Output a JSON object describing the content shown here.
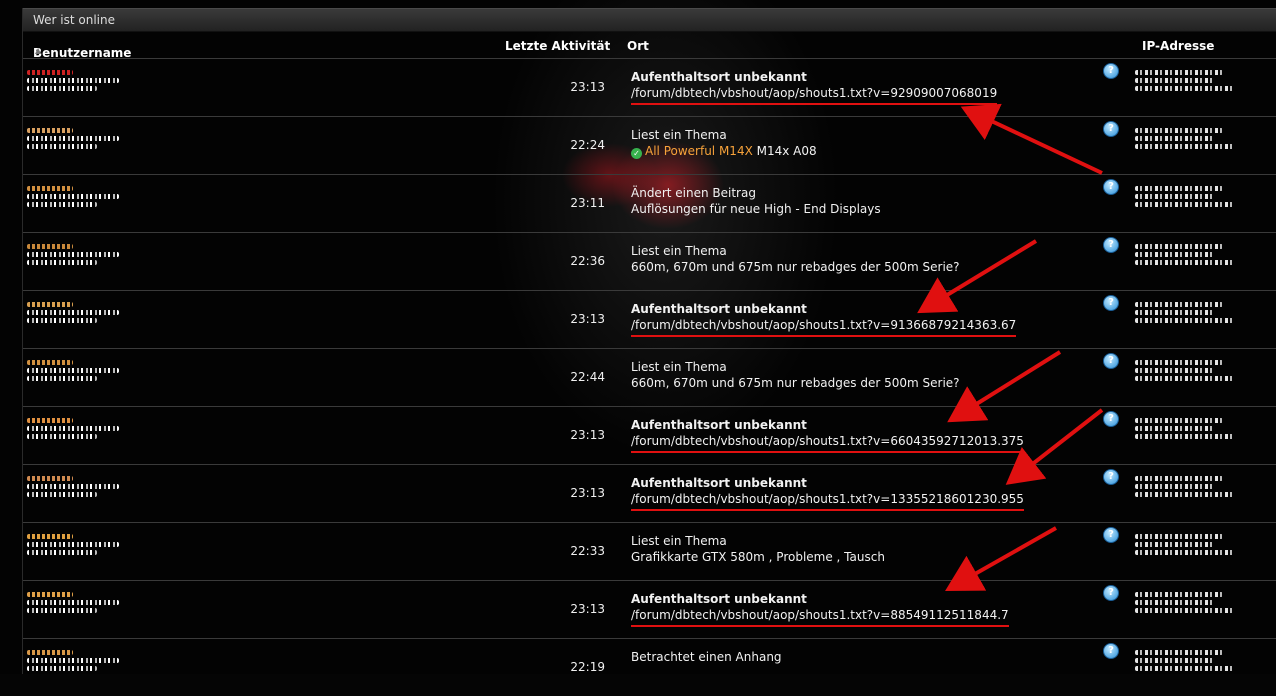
{
  "panel": {
    "title": "Wer ist online"
  },
  "columns": {
    "user": "Benutzername",
    "activity": "Letzte Aktivität",
    "location": "Ort",
    "ip": "IP-Adresse"
  },
  "rows": [
    {
      "time": "23:13",
      "line1": "Aufenthaltsort unbekannt",
      "line2": "/forum/dbtech/vbshout/aop/shouts1.txt?v=92909007068019",
      "bold": true,
      "highlight": true,
      "user_color": "#cc2222"
    },
    {
      "time": "22:24",
      "line1": "Liest ein Thema",
      "thread_link": "All Powerful M14X",
      "thread_suffix": "M14x A08",
      "bold": false,
      "highlight": false,
      "user_color": "#d9a060"
    },
    {
      "time": "23:11",
      "line1": "Ändert einen Beitrag",
      "line2": "Auflösungen für neue High - End Displays",
      "bold": false,
      "highlight": false,
      "user_color": "#d29040"
    },
    {
      "time": "22:36",
      "line1": "Liest ein Thema",
      "line2": "660m, 670m und 675m nur rebadges der 500m Serie?",
      "bold": false,
      "highlight": false,
      "user_color": "#c8883a"
    },
    {
      "time": "23:13",
      "line1": "Aufenthaltsort unbekannt",
      "line2": "/forum/dbtech/vbshout/aop/shouts1.txt?v=91366879214363.67",
      "bold": true,
      "highlight": true,
      "user_color": "#d9a050"
    },
    {
      "time": "22:44",
      "line1": "Liest ein Thema",
      "line2": "660m, 670m und 675m nur rebadges der 500m Serie?",
      "bold": false,
      "highlight": false,
      "user_color": "#d09040"
    },
    {
      "time": "23:13",
      "line1": "Aufenthaltsort unbekannt",
      "line2": "/forum/dbtech/vbshout/aop/shouts1.txt?v=66043592712013.375",
      "bold": true,
      "highlight": true,
      "user_color": "#e09040"
    },
    {
      "time": "23:13",
      "line1": "Aufenthaltsort unbekannt",
      "line2": "/forum/dbtech/vbshout/aop/shouts1.txt?v=13355218601230.955",
      "bold": true,
      "highlight": true,
      "user_color": "#d08a50"
    },
    {
      "time": "22:33",
      "line1": "Liest ein Thema",
      "line2": "Grafikkarte GTX 580m , Probleme , Tausch",
      "bold": false,
      "highlight": false,
      "user_color": "#e0a040"
    },
    {
      "time": "23:13",
      "line1": "Aufenthaltsort unbekannt",
      "line2": "/forum/dbtech/vbshout/aop/shouts1.txt?v=88549112511844.7",
      "bold": true,
      "highlight": true,
      "user_color": "#e0a048"
    },
    {
      "time": "22:19",
      "line1": "Betrachtet einen Anhang",
      "bold": false,
      "highlight": false,
      "user_color": "#d89848"
    }
  ],
  "icons": {
    "help": "help-icon",
    "check": "check-icon"
  },
  "colors": {
    "annotation": "#e01010",
    "thread_link": "#f7a23a"
  }
}
